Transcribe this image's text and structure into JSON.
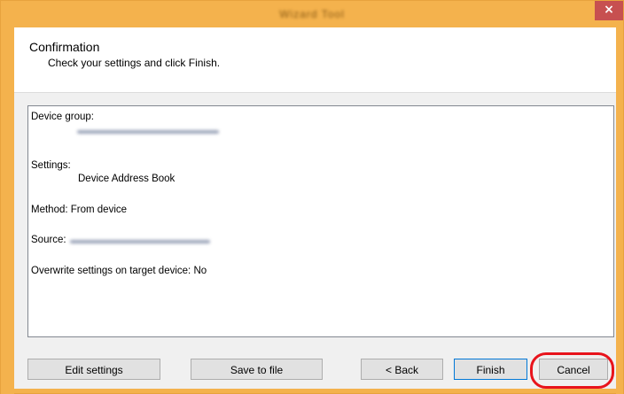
{
  "window": {
    "title": "Wizard Tool",
    "close_glyph": "×",
    "accent_color": "#f4b24d"
  },
  "header": {
    "title": "Confirmation",
    "subtitle": "Check your settings and click Finish."
  },
  "summary": {
    "device_group_label": "Device group:",
    "settings_label": "Settings:",
    "settings_value": "Device Address Book",
    "method_line": "Method: From device",
    "source_label": "Source:",
    "overwrite_line": "Overwrite settings on target device: No"
  },
  "buttons": {
    "edit_settings": "Edit settings",
    "save_to_file": "Save to file",
    "back": "< Back",
    "finish": "Finish",
    "cancel": "Cancel"
  },
  "highlight_color": "#e8141c"
}
